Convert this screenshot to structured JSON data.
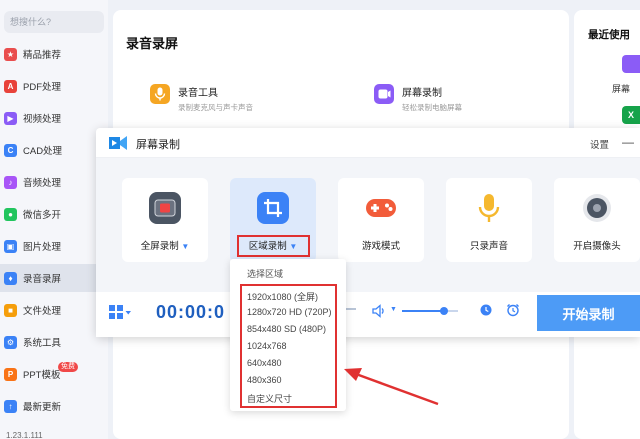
{
  "sidebar": {
    "search_placeholder": "想搜什么?",
    "items": [
      {
        "label": "精品推荐",
        "icon": "star-icon",
        "color": "#e94e4e"
      },
      {
        "label": "PDF处理",
        "icon": "pdf-icon",
        "color": "#e8423a"
      },
      {
        "label": "视频处理",
        "icon": "video-icon",
        "color": "#8b5cf6"
      },
      {
        "label": "CAD处理",
        "icon": "cad-icon",
        "color": "#3b82f6"
      },
      {
        "label": "音频处理",
        "icon": "audio-icon",
        "color": "#a855f7"
      },
      {
        "label": "微信多开",
        "icon": "wechat-icon",
        "color": "#22c55e"
      },
      {
        "label": "图片处理",
        "icon": "image-icon",
        "color": "#3b82f6"
      },
      {
        "label": "录音录屏",
        "icon": "mic-icon",
        "color": "#3b82f6"
      },
      {
        "label": "文件处理",
        "icon": "folder-icon",
        "color": "#f59e0b"
      },
      {
        "label": "系统工具",
        "icon": "gear-icon",
        "color": "#3b82f6"
      },
      {
        "label": "PPT模板",
        "icon": "ppt-icon",
        "color": "#f97316",
        "badge": "免费"
      },
      {
        "label": "最新更新",
        "icon": "update-icon",
        "color": "#3b82f6"
      }
    ],
    "active_index": 7,
    "version": "1.23.1.111"
  },
  "main": {
    "title": "录音录屏",
    "tools": [
      {
        "name": "录音工具",
        "desc": "录制麦克风与声卡声音",
        "icon": "mic-icon",
        "color": "#f5a623"
      },
      {
        "name": "屏幕录制",
        "desc": "轻松录制电脑屏幕",
        "icon": "screen-record-icon",
        "color": "#8b5cf6"
      }
    ]
  },
  "recent": {
    "title": "最近使用",
    "item_label": "屏幕"
  },
  "recorder": {
    "title": "屏幕录制",
    "settings_label": "设置",
    "minimize_label": "—",
    "modes": [
      {
        "label": "全屏录制",
        "icon": "fullscreen-record-icon"
      },
      {
        "label": "区域录制",
        "icon": "crop-icon"
      },
      {
        "label": "游戏模式",
        "icon": "gamepad-icon"
      },
      {
        "label": "只录声音",
        "icon": "microphone-icon"
      },
      {
        "label": "开启摄像头",
        "icon": "webcam-icon"
      }
    ],
    "selected_mode": 1,
    "timer": "00:00:0",
    "start_label": "开始录制",
    "volume_level": 0.75
  },
  "region_dropdown": {
    "header": "选择区域",
    "options": [
      "1920x1080 (全屏)",
      "1280x720 HD (720P)",
      "854x480 SD (480P)",
      "1024x768",
      "640x480",
      "480x360",
      "自定义尺寸"
    ]
  },
  "colors": {
    "accent": "#4d9bf6",
    "timer": "#1f5fbf",
    "highlight": "#e03131"
  }
}
